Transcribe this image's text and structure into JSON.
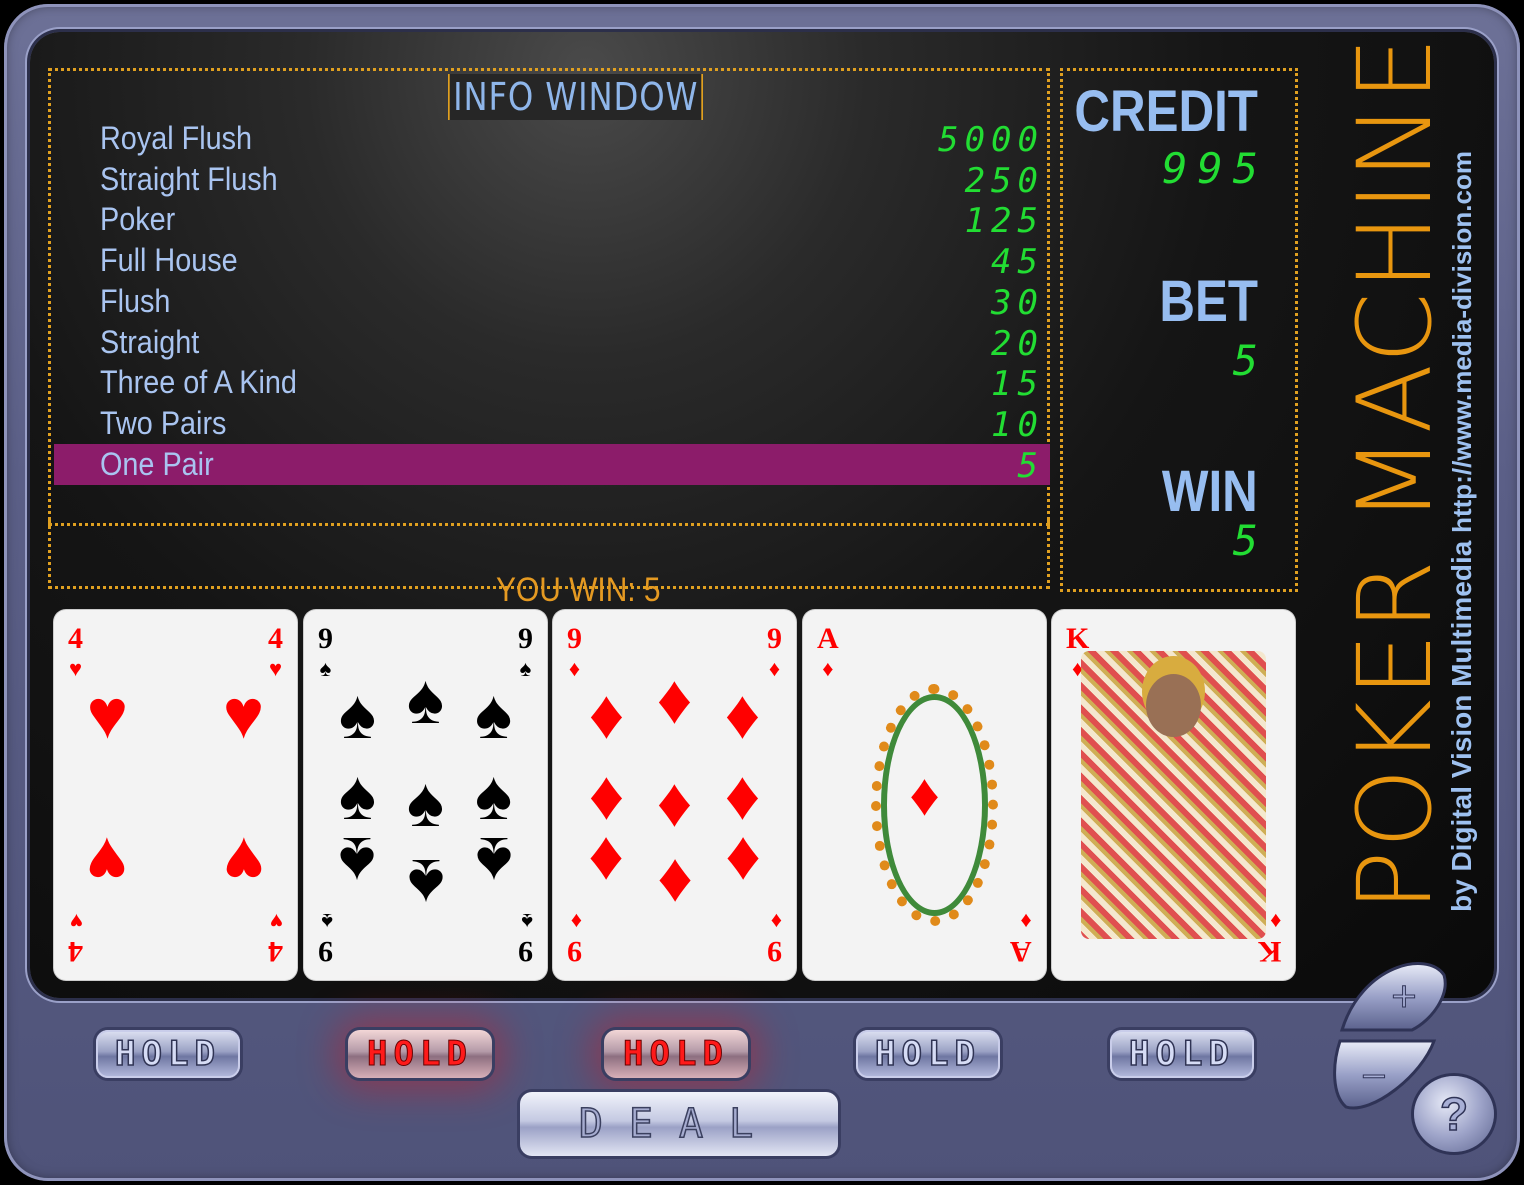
{
  "info": {
    "title": "INFO WINDOW",
    "paytable": [
      {
        "hand": "Royal Flush",
        "pay": "5000"
      },
      {
        "hand": "Straight Flush",
        "pay": "250"
      },
      {
        "hand": "Poker",
        "pay": "125"
      },
      {
        "hand": "Full House",
        "pay": "45"
      },
      {
        "hand": "Flush",
        "pay": "30"
      },
      {
        "hand": "Straight",
        "pay": "20"
      },
      {
        "hand": "Three of A Kind",
        "pay": "15"
      },
      {
        "hand": "Two Pairs",
        "pay": "10"
      },
      {
        "hand": "One Pair",
        "pay": "5"
      }
    ],
    "highlighted_index": 8,
    "you_win": "YOU WIN: 5"
  },
  "stats": {
    "credit_label": "CREDIT",
    "credit_value": "995",
    "bet_label": "BET",
    "bet_value": "5",
    "win_label": "WIN",
    "win_value": "5"
  },
  "brand": {
    "title": "POKER MACHINE",
    "subtitle": "by Digital Vision Multimedia",
    "url": "http://www.media-division.com"
  },
  "cards": [
    {
      "rank": "4",
      "suit": "hearts",
      "symbol": "♥",
      "color": "red"
    },
    {
      "rank": "9",
      "suit": "spades",
      "symbol": "♠",
      "color": "black"
    },
    {
      "rank": "9",
      "suit": "diamonds",
      "symbol": "♦",
      "color": "red"
    },
    {
      "rank": "A",
      "suit": "diamonds",
      "symbol": "♦",
      "color": "red"
    },
    {
      "rank": "K",
      "suit": "diamonds",
      "symbol": "♦",
      "color": "red"
    }
  ],
  "controls": {
    "holds": [
      {
        "label": "HOLD",
        "active": false
      },
      {
        "label": "HOLD",
        "active": true
      },
      {
        "label": "HOLD",
        "active": true
      },
      {
        "label": "HOLD",
        "active": false
      },
      {
        "label": "HOLD",
        "active": false
      }
    ],
    "deal_label": "DEAL",
    "plus_label": "+",
    "minus_label": "−",
    "help_label": "?"
  },
  "colors": {
    "highlight_row": "#8c1c6a",
    "digits": "#22dd33",
    "accent_orange": "#e8960f",
    "label_blue": "#97bdf0"
  }
}
